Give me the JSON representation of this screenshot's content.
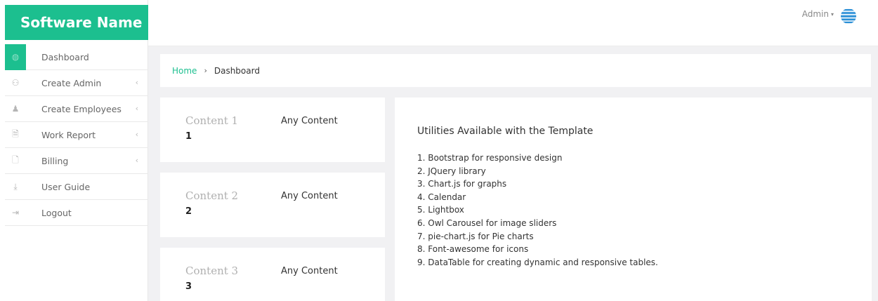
{
  "brand": {
    "name": "Software Name"
  },
  "sidebar": {
    "items": [
      {
        "label": "Dashboard",
        "icon": "dashboard-icon",
        "glyph": "◍",
        "has_chevron": false,
        "active": true
      },
      {
        "label": "Create Admin",
        "icon": "user-plus-icon",
        "glyph": "⚇",
        "has_chevron": true,
        "active": false
      },
      {
        "label": "Create Employees",
        "icon": "user-icon",
        "glyph": "♟",
        "has_chevron": true,
        "active": false
      },
      {
        "label": "Work Report",
        "icon": "file-text-icon",
        "glyph": "🗎",
        "has_chevron": true,
        "active": false
      },
      {
        "label": "Billing",
        "icon": "file-pdf-icon",
        "glyph": "🗋",
        "has_chevron": true,
        "active": false
      },
      {
        "label": "User Guide",
        "icon": "download-icon",
        "glyph": "⤓",
        "has_chevron": false,
        "active": false
      },
      {
        "label": "Logout",
        "icon": "sign-out-icon",
        "glyph": "⇥",
        "has_chevron": false,
        "active": false
      }
    ],
    "chevron_glyph": "‹"
  },
  "header": {
    "user_label": "Admin",
    "caret_glyph": "▾"
  },
  "breadcrumb": {
    "home": "Home",
    "separator": "›",
    "current": "Dashboard"
  },
  "cards": [
    {
      "title": "Content 1",
      "number": "1",
      "text": "Any Content"
    },
    {
      "title": "Content 2",
      "number": "2",
      "text": "Any Content"
    },
    {
      "title": "Content 3",
      "number": "3",
      "text": "Any Content"
    }
  ],
  "utilities": {
    "heading": "Utilities Available with the Template",
    "items": [
      "1. Bootstrap for responsive design",
      "2. JQuery library",
      "3. Chart.js for graphs",
      "4. Calendar",
      "5. Lightbox",
      "6. Owl Carousel for image sliders",
      "7. pie-chart.js for Pie charts",
      "8. Font-awesome for icons",
      "9. DataTable for creating dynamic and responsive tables."
    ]
  },
  "colors": {
    "accent": "#1cbf8f",
    "background": "#f1f1f3",
    "avatar_blue": "#2a8fd6"
  }
}
